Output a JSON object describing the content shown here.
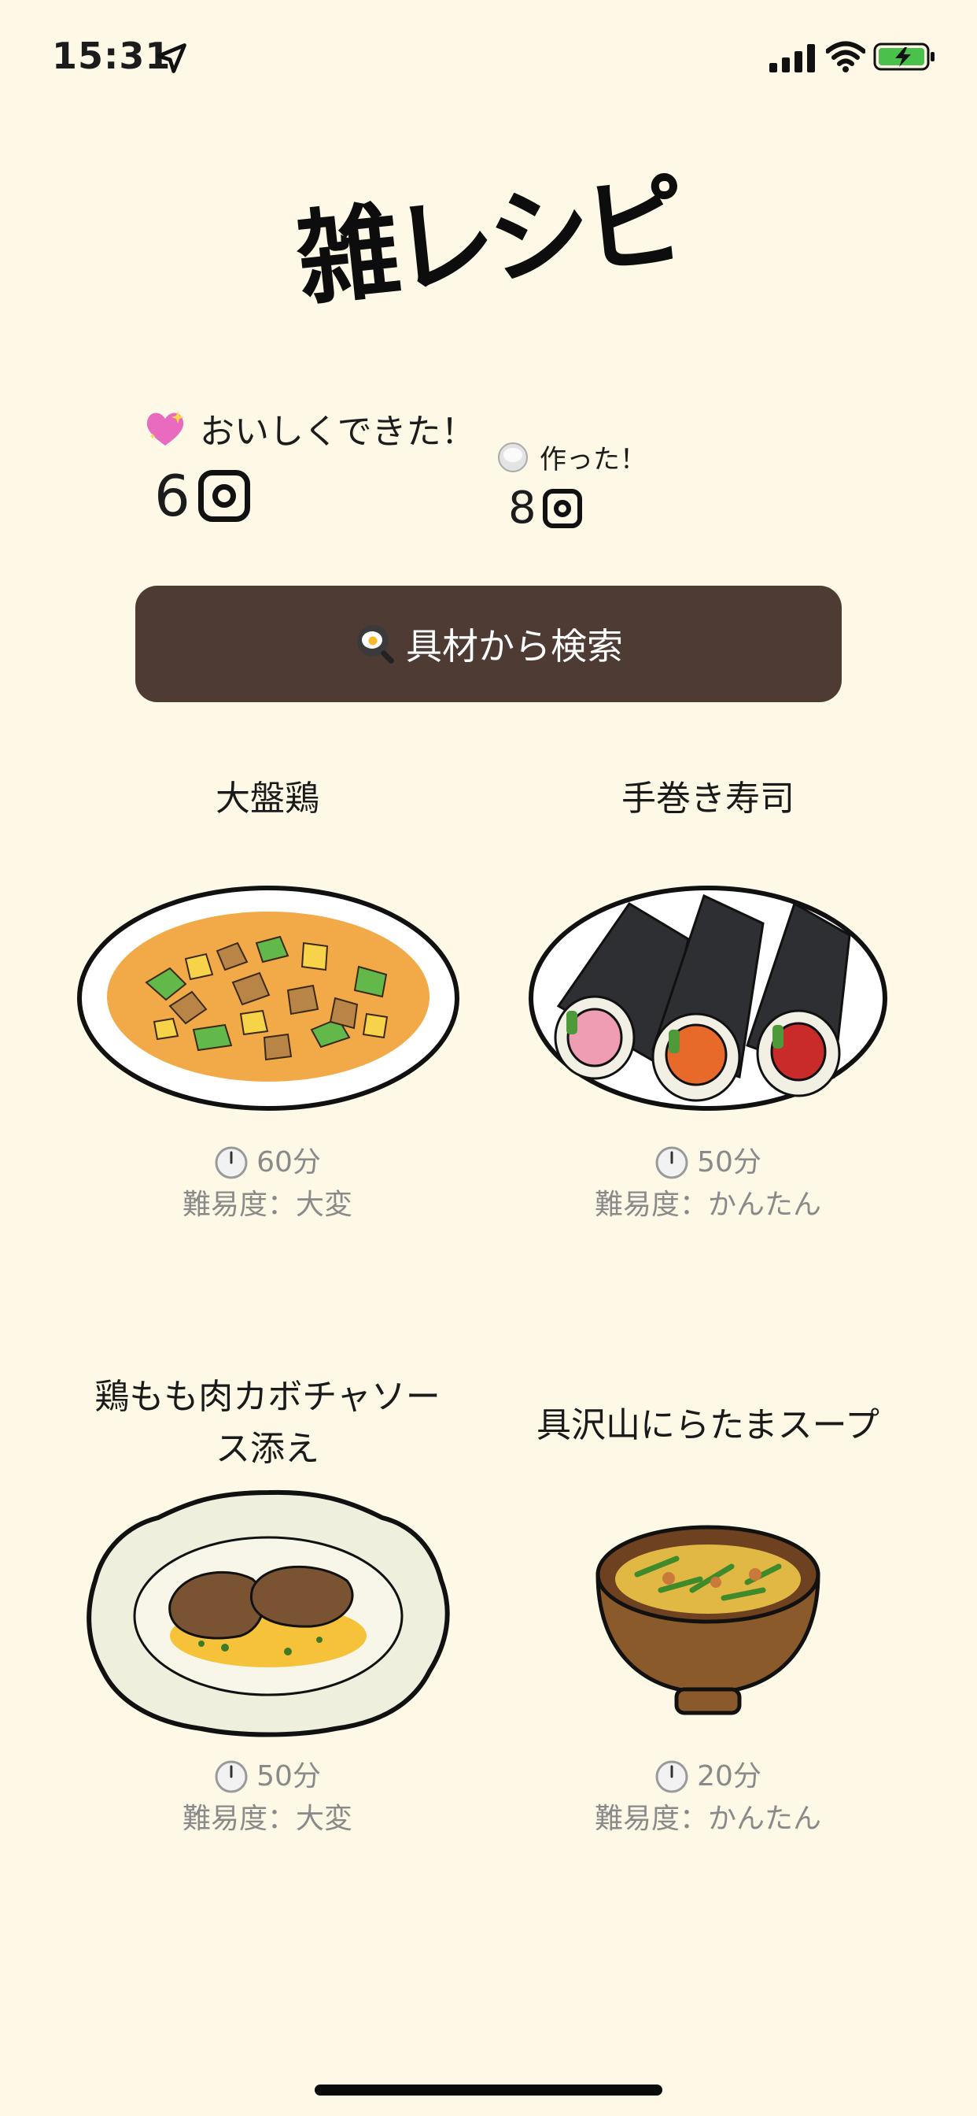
{
  "status_bar": {
    "time": "15:31"
  },
  "app": {
    "logo_text": "雑レシピ"
  },
  "stats": {
    "delicious": {
      "label": "おいしくできた！",
      "count": "6"
    },
    "made": {
      "label": "作った！",
      "count": "8"
    }
  },
  "search": {
    "label": "具材から検索"
  },
  "recipes": [
    {
      "title": "大盤鶏",
      "time": "60分",
      "difficulty": "難易度：大変"
    },
    {
      "title": "手巻き寿司",
      "time": "50分",
      "difficulty": "難易度：かんたん"
    },
    {
      "title_line1": "鶏もも肉カボチャソー",
      "title_line2": "ス添え",
      "time": "50分",
      "difficulty": "難易度：大変"
    },
    {
      "title": "具沢山にらたまスープ",
      "time": "20分",
      "difficulty": "難易度：かんたん"
    }
  ],
  "colors": {
    "background": "#fdf9e6",
    "button": "#4d3b34",
    "meta_text": "#8a8a8a"
  }
}
